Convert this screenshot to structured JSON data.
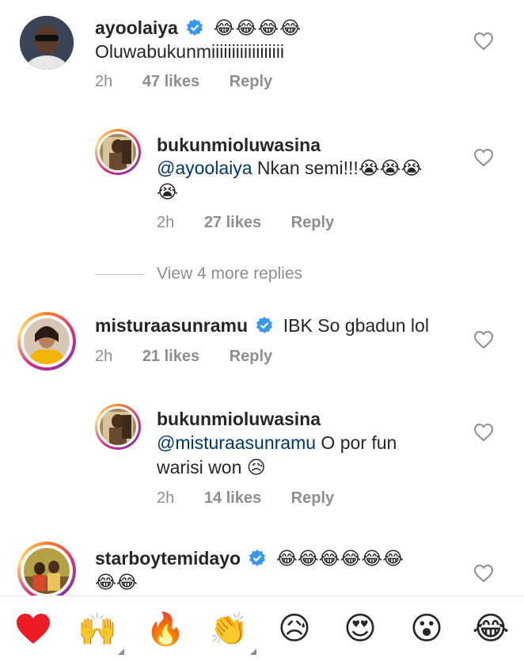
{
  "comments": [
    {
      "username": "ayoolaiya",
      "verified": true,
      "text": "Oluwabukunmiiiiiiiiiiiiiiiiii",
      "emojis": "😂😂😂😂",
      "time": "2h",
      "likes": "47 likes",
      "reply": "Reply"
    },
    {
      "username": "bukunmioluwasina",
      "verified": false,
      "mention": "@ayoolaiya",
      "text": "Nkan semi!!!",
      "emojis_line1": "😭😭😭",
      "emojis_line2": "😭",
      "time": "2h",
      "likes": "27 likes",
      "reply": "Reply"
    },
    {
      "username": "misturaasunramu",
      "verified": true,
      "text": "IBK So gbadun lol",
      "time": "2h",
      "likes": "21 likes",
      "reply": "Reply"
    },
    {
      "username": "bukunmioluwasina",
      "verified": false,
      "mention": "@misturaasunramu",
      "text_line1": "O por fun",
      "text_line2": "warisi won",
      "emojis": "😥",
      "time": "2h",
      "likes": "14 likes",
      "reply": "Reply"
    },
    {
      "username": "starboytemidayo",
      "verified": true,
      "emojis_line1": "😂😂😂😂😂😂",
      "emojis_line2": "😂😂"
    }
  ],
  "view_more": "View 4 more replies",
  "reactions": [
    "❤️",
    "🙌",
    "🔥",
    "👏",
    "😥",
    "😍",
    "😮",
    "😂"
  ],
  "colors": {
    "verified": "#3897f0",
    "meta": "#8e8e8e",
    "mention": "#00376b",
    "heart_reaction": "#ed1c24"
  }
}
